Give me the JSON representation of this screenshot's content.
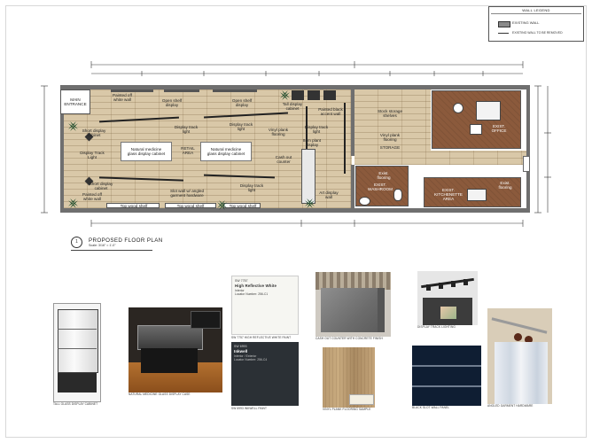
{
  "legend": {
    "title": "WALL LEGEND",
    "items": [
      {
        "label": "EXISTING WALL",
        "kind": "existing"
      },
      {
        "label": "EXISTING WALL TO BE REMOVED",
        "kind": "removed"
      }
    ]
  },
  "plan": {
    "title_number": "1",
    "title": "PROPOSED FLOOR PLAN",
    "scale": "Scale: 3/16\" = 1'-0\"",
    "labels": {
      "main_entrance": "MAIN\nENTRANCE",
      "painted_white_wall_tl": "Painted off\nwhite wall",
      "open_shelf_display_1": "Open shelf\ndisplay",
      "open_shelf_display_2": "Open shelf\ndisplay",
      "tall_display_cabinet": "Tall display\ncabinet",
      "painted_black_accent_wall": "Painted black\naccent wall",
      "short_display_cabinet_1": "Short display\ncabinet",
      "display_track_light_1": "Display track\nlight",
      "display_track_light_2": "Display track\nlight",
      "display_track_light_3": "Display track\nlight",
      "display_track_light_4": "Display Track\nLight",
      "display_track_light_5": "Display track\nlight",
      "vinyl_plank_flooring_1": "Vinyl plank\nflooring",
      "vinyl_plank_flooring_2": "Vinyl plank\nflooring",
      "natural_medicine_1": "Natural medicine\nglass display cabinet",
      "natural_medicine_2": "Natural medicine\nglass display cabinet",
      "retail_area": "RETAIL\nAREA",
      "item_plant_display": "Item plant\ndisplay",
      "cash_out_counter": "Cash out\ncounter",
      "short_display_cabinet_2": "Short display\ncabinet",
      "slot_wall": "Slot wall w/ angled\ngarment hardware",
      "painted_white_wall_bl": "Painted off\nwhite wall",
      "top_wood_shelf_1": "Top wood shelf",
      "top_wood_shelf_2": "Top wood shelf",
      "top_wood_shelf_3": "Top wood shelf",
      "art_display_wall": "Art display\nwall",
      "stock_storage_shelves": "Stock storage\nshelves",
      "storage": "STORAGE",
      "exist_flooring_1": "Exist.\nflooring",
      "exist_washroom": "EXIST.\nWASHROOM",
      "exist_kitchenette": "EXIST.\nKITCHENETTE\nAREA",
      "exist_flooring_2": "Exist.\nflooring",
      "exist_office": "EXIST.\nOFFICE"
    }
  },
  "samples": {
    "cabinet_caption": "TALL GLASS DISPLAY CABINET",
    "display_case_caption": "NATURAL MEDICINE GLASS DISPLAY CASE",
    "paint_white": {
      "code": "SW 7757",
      "name": "High Reflective White",
      "line1": "Interior",
      "line2": "Locator Number: 256-C1",
      "caption": "SW 7757 HIGH REFLECTIVE WHITE PAINT"
    },
    "paint_black": {
      "code": "SW 6993",
      "name": "Inkwell",
      "line1": "Interior / Exterior",
      "line2": "Locator Number: 256-C4",
      "caption": "SW 6993 INKWELL PAINT"
    },
    "counter_caption": "CASH OUT COUNTER WITH CONCRETE FINISH",
    "vinyl_caption": "VINYL PLANK FLOORING SAMPLE",
    "track_light_caption": "DISPLAY TRACK LIGHTING",
    "slot_wall_caption": "BLACK SLOT WALL PANEL",
    "garment_caption": "ANGLED GARMENT HARDWARE"
  },
  "colors": {
    "wood": "#d9c8a8",
    "dark_wood": "#8b5a3c",
    "wall": "#6f6f6f",
    "inkwell": "#2b3035",
    "slot_navy": "#0f1e33"
  }
}
